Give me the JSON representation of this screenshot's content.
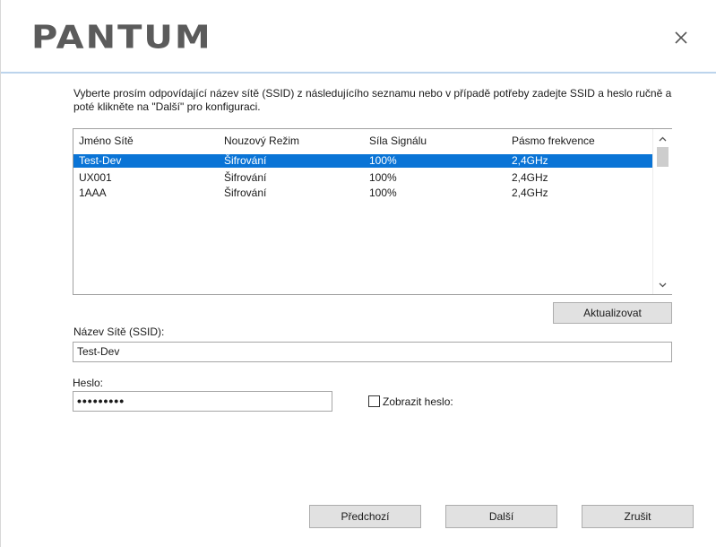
{
  "header": {
    "logo": "PANTUM",
    "close_label": "×"
  },
  "instructions": "Vyberte prosím odpovídající název sítě (SSID) z následujícího seznamu nebo v případě potřeby zadejte SSID a heslo ručně a poté klikněte na \"Další\" pro konfiguraci.",
  "network_list": {
    "columns": [
      "Jméno Sítě",
      "Nouzový Režim",
      "Síla Signálu",
      "Pásmo frekvence"
    ],
    "rows": [
      [
        "Test-Dev",
        "Šifrování",
        "100%",
        "2,4GHz"
      ],
      [
        "UX001",
        "Šifrování",
        "100%",
        "2,4GHz"
      ],
      [
        "1AAA",
        "Šifrování",
        "100%",
        "2,4GHz"
      ]
    ],
    "selected_index": 0
  },
  "refresh_button": "Aktualizovat",
  "ssid": {
    "label": "Název Sítě (SSID):",
    "value": "Test-Dev"
  },
  "password": {
    "label": "Heslo:",
    "value": "•••••••••",
    "show_label": "Zobrazit heslo:",
    "show_checked": false
  },
  "footer": {
    "back": "Předchozí",
    "next": "Další",
    "cancel": "Zrušit"
  },
  "colors": {
    "selection": "#0a74d6",
    "header_line": "#bcd4ec",
    "logo": "#5b5b5b"
  }
}
